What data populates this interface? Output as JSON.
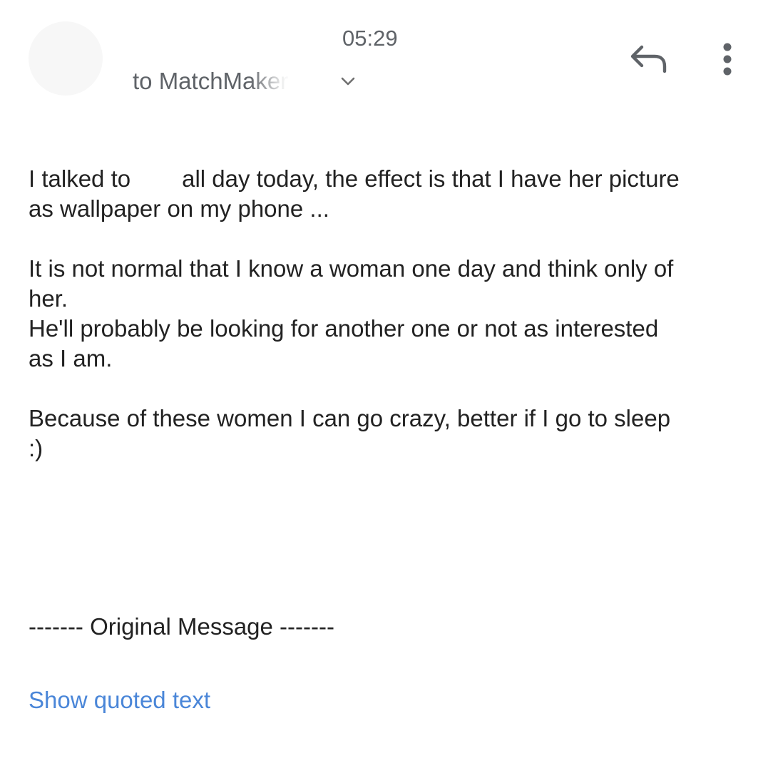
{
  "header": {
    "sender_name": "",
    "time": "05:29",
    "recipient": "to MatchMaker"
  },
  "body": {
    "paragraph1_line1_before": "I talked to",
    "paragraph1_line1_after": "all day today, the effect is that I have her picture",
    "paragraph1_line2": "as wallpaper on my phone ...",
    "paragraph2_line1": "It is not normal that I know a woman one day and think only of",
    "paragraph2_line2": "her.",
    "paragraph2_line3": "He'll probably be looking for another one or not as interested",
    "paragraph2_line4": "as I am.",
    "paragraph3_line1": "Because of these women I can go crazy, better if I go to sleep",
    "paragraph3_line2": ":)"
  },
  "original_message_divider": "------- Original Message -------",
  "show_quoted_text": "Show quoted text",
  "colors": {
    "text": "#222222",
    "secondary": "#5f6368",
    "link": "#4a86d8"
  },
  "icons": {
    "reply": "reply-icon",
    "more": "more-vert-icon",
    "expand": "chevron-down-icon"
  }
}
